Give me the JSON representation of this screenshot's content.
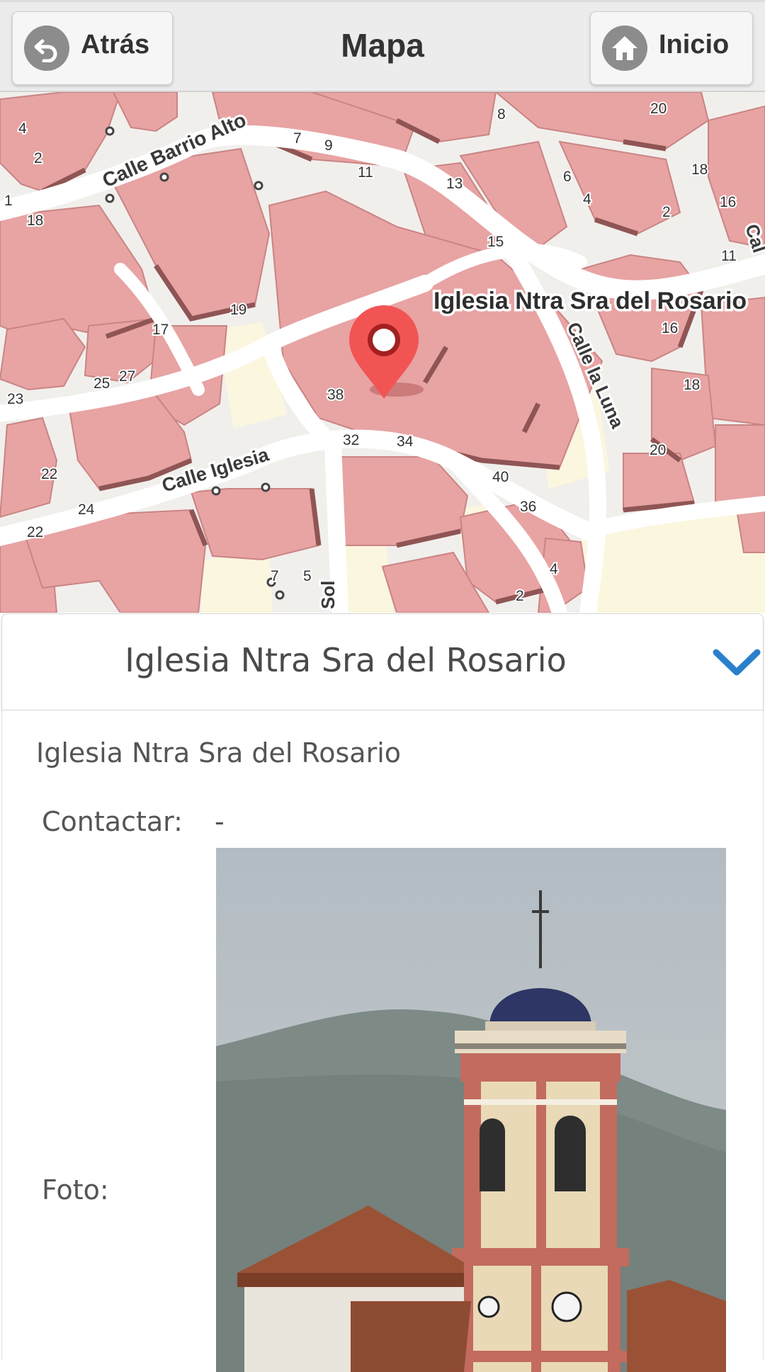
{
  "header": {
    "back_label": "Atrás",
    "title": "Mapa",
    "home_label": "Inicio"
  },
  "map": {
    "place_label": "Iglesia Ntra Sra del Rosario",
    "streets": {
      "barrio_alto": "Calle Barrio Alto",
      "iglesia": "Calle Iglesia",
      "luna": "Calle la Luna",
      "sol": "Sol",
      "cal": "Cal"
    },
    "house_numbers": {
      "n4": "4",
      "n2": "2",
      "n1": "1",
      "n18a": "18",
      "n7a": "7",
      "n9": "9",
      "n11a": "11",
      "n8": "8",
      "n20a": "20",
      "n13": "13",
      "n6": "6",
      "n4b": "4",
      "n2b": "2",
      "n18b": "18",
      "n16a": "16",
      "n15": "15",
      "n11b": "11",
      "n19": "19",
      "n17": "17",
      "n16b": "16",
      "n18c": "18",
      "n25": "25",
      "n27": "27",
      "n23": "23",
      "n38": "38",
      "n32": "32",
      "n34": "34",
      "n20b": "20",
      "n40": "40",
      "n22a": "22",
      "n24": "24",
      "n36": "36",
      "n22b": "22",
      "n7b": "7",
      "n5": "5",
      "n4c": "4",
      "n2c": "2"
    },
    "colors": {
      "building": "#e8a3a3",
      "building_edge": "#9b5d5d",
      "road": "#ffffff",
      "land": "#f1efec",
      "yard": "#fbf6de",
      "pin": "#f25454"
    }
  },
  "panel": {
    "title": "Iglesia Ntra Sra del Rosario",
    "description": "Iglesia Ntra Sra del Rosario",
    "contact_label": "Contactar:",
    "contact_value": "-",
    "photo_label": "Foto:"
  },
  "icons": {
    "back": "back-arrow-icon",
    "home": "home-icon",
    "collapse": "chevron-down-icon",
    "marker": "map-pin-icon"
  },
  "accent_color": "#2a7fcc"
}
